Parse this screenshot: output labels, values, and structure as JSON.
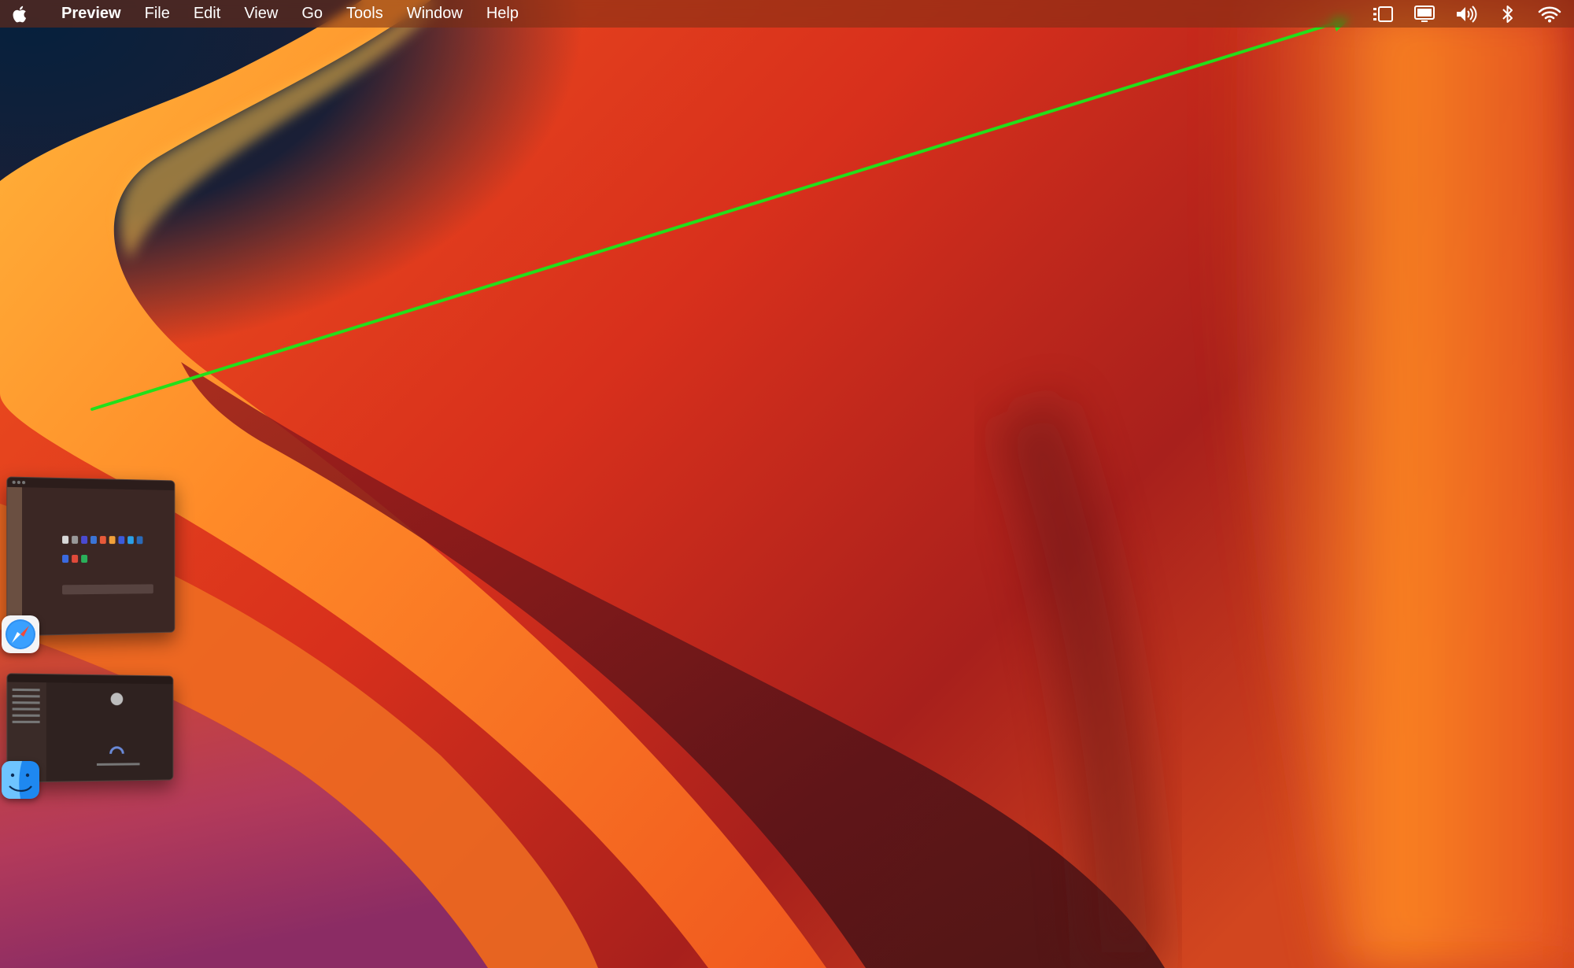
{
  "menubar": {
    "apple_icon": "apple-logo-icon",
    "app_name": "Preview",
    "items": [
      "File",
      "Edit",
      "View",
      "Go",
      "Tools",
      "Window",
      "Help"
    ],
    "status_icons": [
      "stage-manager-icon",
      "display-icon",
      "volume-icon",
      "bluetooth-icon",
      "wifi-icon"
    ]
  },
  "stage_manager": {
    "groups": [
      {
        "app": "Safari",
        "icon": "safari-icon"
      },
      {
        "app": "Finder",
        "icon": "finder-icon"
      }
    ]
  },
  "annotation": {
    "type": "arrow",
    "color": "#22e01a"
  },
  "colors": {
    "wallpaper_orange": "#ff9a2a",
    "wallpaper_red": "#c8261a",
    "wallpaper_dark": "#0b1d33"
  }
}
